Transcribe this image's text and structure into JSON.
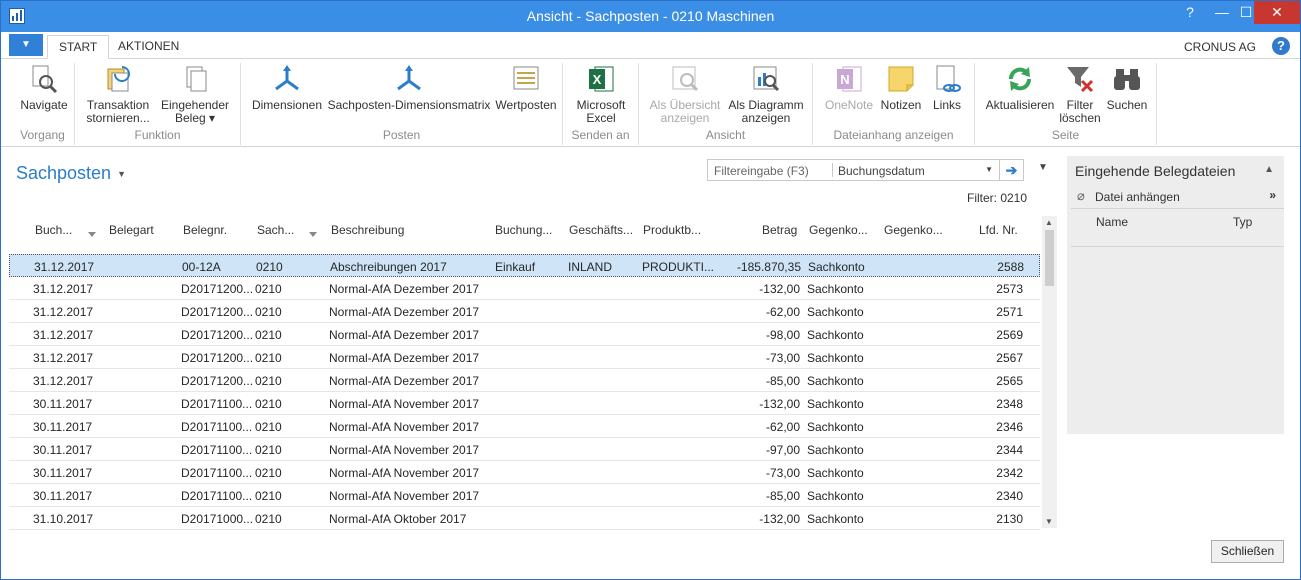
{
  "window": {
    "title": "Ansicht - Sachposten - 0210 Maschinen"
  },
  "tabs": {
    "start": "START",
    "aktionen": "AKTIONEN",
    "company": "CRONUS AG"
  },
  "ribbon": {
    "navigate": "Navigate",
    "g_vorgang": "Vorgang",
    "transaktion": "Transaktion",
    "stornieren": "stornieren...",
    "eingehender": "Eingehender",
    "beleg": "Beleg ▾",
    "g_funktion": "Funktion",
    "dimensionen": "Dimensionen",
    "matrix": "Sachposten-Dimensionsmatrix",
    "wertposten": "Wertposten",
    "g_posten": "Posten",
    "ms": "Microsoft",
    "excel": "Excel",
    "g_senden": "Senden an",
    "als_uebersicht": "Als Übersicht",
    "anzeigen1": "anzeigen",
    "als_diagramm": "Als Diagramm",
    "anzeigen2": "anzeigen",
    "g_ansicht": "Ansicht",
    "onenote": "OneNote",
    "notizen": "Notizen",
    "links": "Links",
    "g_dateianhang": "Dateianhang anzeigen",
    "aktualisieren": "Aktualisieren",
    "filter": "Filter",
    "loeschen": "löschen",
    "suchen": "Suchen",
    "g_seite": "Seite"
  },
  "page": {
    "title": "Sachposten",
    "filter_placeholder": "Filtereingabe (F3)",
    "filter_field": "Buchungsdatum",
    "filter_status": "Filter: 0210"
  },
  "columns": {
    "buchungsdatum": "Buch...",
    "belegart": "Belegart",
    "belegnr": "Belegnr.",
    "sachkonto": "Sach...",
    "beschreibung": "Beschreibung",
    "buchungsart": "Buchung...",
    "geschaefts": "Geschäfts...",
    "produkt": "Produktb...",
    "betrag": "Betrag",
    "gegenkontoart": "Gegenko...",
    "gegenkonto": "Gegenko...",
    "lfdnr": "Lfd. Nr."
  },
  "rows": [
    {
      "date": "31.12.2017",
      "belegnr": "00-12A",
      "konto": "0210",
      "desc": "Abschreibungen 2017",
      "art": "Einkauf",
      "gb": "INLAND",
      "pb": "PRODUKTI...",
      "betrag": "-185.870,35",
      "gart": "Sachkonto",
      "lfd": "2588"
    },
    {
      "date": "31.12.2017",
      "belegnr": "D20171200...",
      "konto": "0210",
      "desc": "Normal-AfA Dezember 2017",
      "art": "",
      "gb": "",
      "pb": "",
      "betrag": "-132,00",
      "gart": "Sachkonto",
      "lfd": "2573"
    },
    {
      "date": "31.12.2017",
      "belegnr": "D20171200...",
      "konto": "0210",
      "desc": "Normal-AfA Dezember 2017",
      "art": "",
      "gb": "",
      "pb": "",
      "betrag": "-62,00",
      "gart": "Sachkonto",
      "lfd": "2571"
    },
    {
      "date": "31.12.2017",
      "belegnr": "D20171200...",
      "konto": "0210",
      "desc": "Normal-AfA Dezember 2017",
      "art": "",
      "gb": "",
      "pb": "",
      "betrag": "-98,00",
      "gart": "Sachkonto",
      "lfd": "2569"
    },
    {
      "date": "31.12.2017",
      "belegnr": "D20171200...",
      "konto": "0210",
      "desc": "Normal-AfA Dezember 2017",
      "art": "",
      "gb": "",
      "pb": "",
      "betrag": "-73,00",
      "gart": "Sachkonto",
      "lfd": "2567"
    },
    {
      "date": "31.12.2017",
      "belegnr": "D20171200...",
      "konto": "0210",
      "desc": "Normal-AfA Dezember 2017",
      "art": "",
      "gb": "",
      "pb": "",
      "betrag": "-85,00",
      "gart": "Sachkonto",
      "lfd": "2565"
    },
    {
      "date": "30.11.2017",
      "belegnr": "D20171100...",
      "konto": "0210",
      "desc": "Normal-AfA November 2017",
      "art": "",
      "gb": "",
      "pb": "",
      "betrag": "-132,00",
      "gart": "Sachkonto",
      "lfd": "2348"
    },
    {
      "date": "30.11.2017",
      "belegnr": "D20171100...",
      "konto": "0210",
      "desc": "Normal-AfA November 2017",
      "art": "",
      "gb": "",
      "pb": "",
      "betrag": "-62,00",
      "gart": "Sachkonto",
      "lfd": "2346"
    },
    {
      "date": "30.11.2017",
      "belegnr": "D20171100...",
      "konto": "0210",
      "desc": "Normal-AfA November 2017",
      "art": "",
      "gb": "",
      "pb": "",
      "betrag": "-97,00",
      "gart": "Sachkonto",
      "lfd": "2344"
    },
    {
      "date": "30.11.2017",
      "belegnr": "D20171100...",
      "konto": "0210",
      "desc": "Normal-AfA November 2017",
      "art": "",
      "gb": "",
      "pb": "",
      "betrag": "-73,00",
      "gart": "Sachkonto",
      "lfd": "2342"
    },
    {
      "date": "30.11.2017",
      "belegnr": "D20171100...",
      "konto": "0210",
      "desc": "Normal-AfA November 2017",
      "art": "",
      "gb": "",
      "pb": "",
      "betrag": "-85,00",
      "gart": "Sachkonto",
      "lfd": "2340"
    },
    {
      "date": "31.10.2017",
      "belegnr": "D20171000...",
      "konto": "0210",
      "desc": "Normal-AfA Oktober 2017",
      "art": "",
      "gb": "",
      "pb": "",
      "betrag": "-132,00",
      "gart": "Sachkonto",
      "lfd": "2130"
    }
  ],
  "factbox": {
    "title": "Eingehende Belegdateien",
    "attach": "Datei anhängen",
    "col_name": "Name",
    "col_type": "Typ"
  },
  "footer": {
    "close": "Schließen"
  }
}
